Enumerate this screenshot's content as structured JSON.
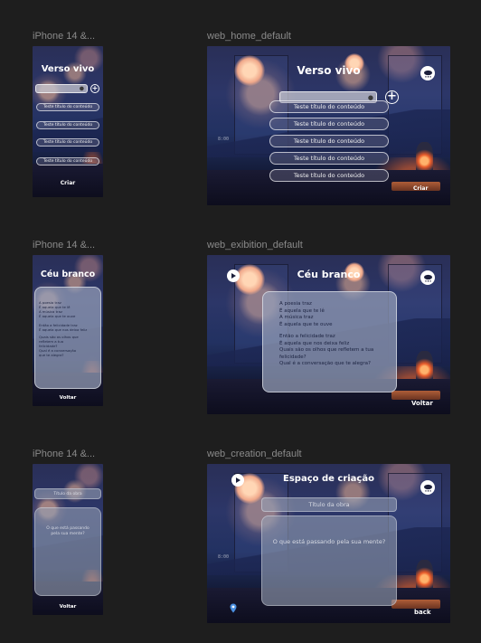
{
  "frames": {
    "mobile_home": {
      "label": "iPhone 14 &..."
    },
    "web_home": {
      "label": "web_home_default"
    },
    "mobile_exhibition": {
      "label": "iPhone 14 &..."
    },
    "web_exhibition": {
      "label": "web_exibition_default"
    },
    "mobile_creation": {
      "label": "iPhone 14 &..."
    },
    "web_creation": {
      "label": "web_creation_default"
    }
  },
  "home": {
    "title": "Verso vivo",
    "items": [
      "Teste título do conteúdo",
      "Teste título do conteúdo",
      "Teste título do conteúdo",
      "Teste título do conteúdo",
      "Teste título do conteúdo"
    ],
    "create_label": "Criar",
    "search_icon": "search-icon",
    "add_icon": "plus-circle-icon",
    "weather_icon": "rain-cloud-icon"
  },
  "exhibition": {
    "title": "Céu branco",
    "stanza1": [
      "A poesia traz",
      "É aquela que te lê",
      "A música traz",
      "É aquela que te ouve"
    ],
    "stanza2": [
      "Então a felicidade traz",
      "É aquela que nos deixa feliz",
      "Quais são os olhos que refletem a tua felicidade?",
      "Qual é a conversação que te alegra?"
    ],
    "back_label": "Voltar",
    "play_icon": "play-icon",
    "weather_icon": "rain-cloud-icon"
  },
  "creation": {
    "title": "Espaço de criação",
    "title_placeholder": "Título da obra",
    "body_placeholder": "O que está passando pela sua mente?",
    "mobile_back_label": "Voltar",
    "web_back_label": "back",
    "play_icon": "play-icon",
    "weather_icon": "rain-cloud-icon",
    "pin_icon": "map-pin-icon"
  },
  "scene_text": "8:00",
  "colors": {
    "background": "#1e1e1e",
    "label": "#8a8a8a",
    "text_light": "#ffffff",
    "poem_text": "#1c2340"
  }
}
